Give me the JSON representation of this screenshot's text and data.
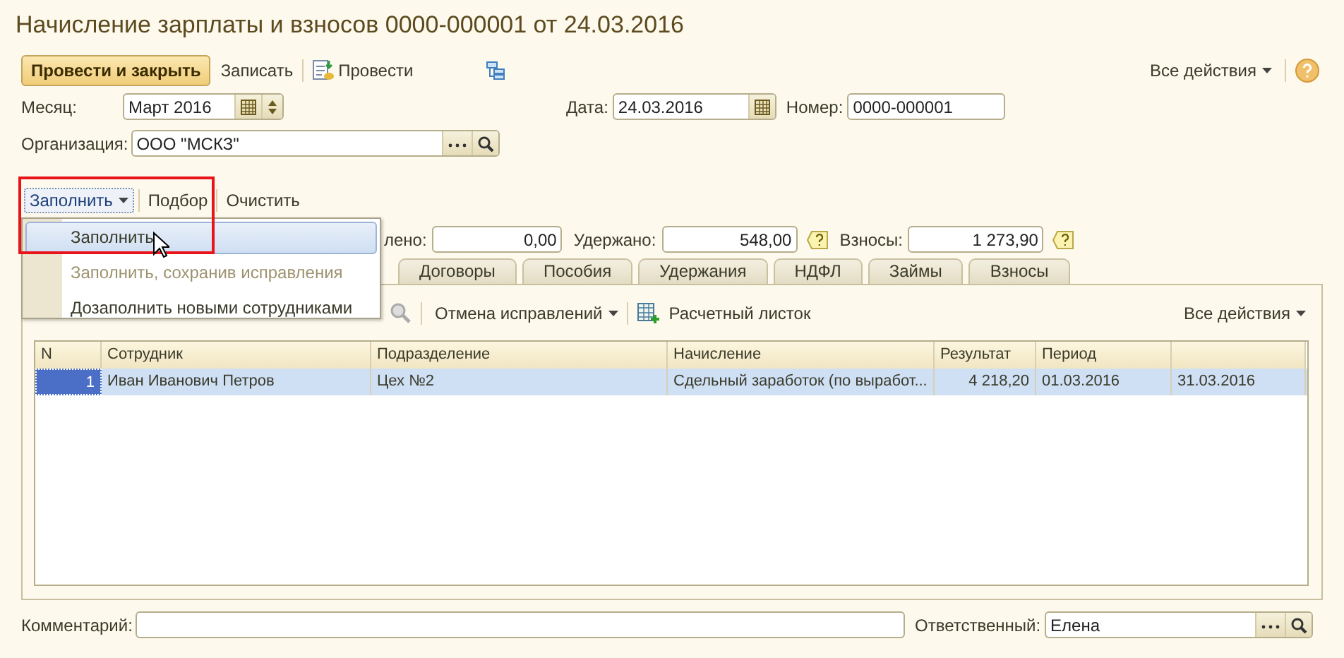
{
  "window": {
    "title": "Начисление зарплаты и взносов 0000-000001 от 24.03.2016"
  },
  "command_bar": {
    "primary": "Провести и закрыть",
    "save": "Записать",
    "post": "Провести",
    "all_actions": "Все действия"
  },
  "header": {
    "month": {
      "label": "Месяц:",
      "value": "Март 2016"
    },
    "date": {
      "label": "Дата:",
      "value": "24.03.2016"
    },
    "number": {
      "label": "Номер:",
      "value": "0000-000001"
    },
    "organization": {
      "label": "Организация:",
      "value": "ООО \"МСКЗ\""
    }
  },
  "fill_bar": [
    {
      "label": "Заполнить",
      "dropdown": true
    },
    {
      "label": "Подбор",
      "dropdown": false
    },
    {
      "label": "Очистить",
      "dropdown": false
    }
  ],
  "fill_menu": [
    {
      "label": "Заполнить",
      "selected": true,
      "disabled": false
    },
    {
      "label": "Заполнить, сохранив исправления",
      "selected": false,
      "disabled": true
    },
    {
      "label": "Дозаполнить новыми сотрудниками",
      "selected": false,
      "disabled": false
    }
  ],
  "totals": [
    {
      "label": "лено:",
      "value": "0,00",
      "help": false
    },
    {
      "label": "Удержано:",
      "value": "548,00",
      "help": true
    },
    {
      "label": "Взносы:",
      "value": "1 273,90",
      "help": true
    }
  ],
  "tabs": [
    {
      "label": "Договоры",
      "selected": false
    },
    {
      "label": "Пособия",
      "selected": false
    },
    {
      "label": "Удержания",
      "selected": false
    },
    {
      "label": "НДФЛ",
      "selected": false
    },
    {
      "label": "Займы",
      "selected": false
    },
    {
      "label": "Взносы",
      "selected": false
    }
  ],
  "table_toolbar": {
    "cancel": "Отмена исправлений",
    "payslip": "Расчетный листок",
    "all_actions": "Все действия"
  },
  "table": {
    "columns": [
      "N",
      "Сотрудник",
      "Подразделение",
      "Начисление",
      "Результат",
      "Период"
    ],
    "rows": [
      {
        "selected": true,
        "cells": [
          "1",
          "Иван Иванович Петров",
          "Цех №2",
          "Сдельный заработок (по выработ...",
          "4 218,20",
          "01.03.2016",
          "31.03.2016"
        ]
      }
    ]
  },
  "footer": {
    "comment": {
      "label": "Комментарий:"
    },
    "responsible": {
      "label": "Ответственный:",
      "value": "Елена"
    }
  }
}
